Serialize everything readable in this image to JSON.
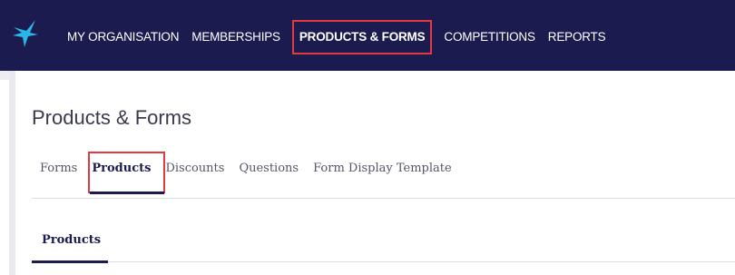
{
  "topnav": {
    "logo": "star-logo",
    "items": [
      {
        "label": "MY ORGANISATION",
        "active": false
      },
      {
        "label": "MEMBERSHIPS",
        "active": false
      },
      {
        "label": "PRODUCTS & FORMS",
        "active": true
      },
      {
        "label": "COMPETITIONS",
        "active": false
      },
      {
        "label": "REPORTS",
        "active": false
      }
    ]
  },
  "page": {
    "title": "Products & Forms"
  },
  "tabs": [
    {
      "label": "Forms",
      "active": false
    },
    {
      "label": "Products",
      "active": true
    },
    {
      "label": "Discounts",
      "active": false
    },
    {
      "label": "Questions",
      "active": false
    },
    {
      "label": "Form Display Template",
      "active": false
    }
  ],
  "section": {
    "heading": "Products"
  },
  "colors": {
    "navbar": "#1b1b4f",
    "accent": "#29b6e8",
    "highlight": "#e0393f",
    "active_text": "#1b1b4f"
  }
}
